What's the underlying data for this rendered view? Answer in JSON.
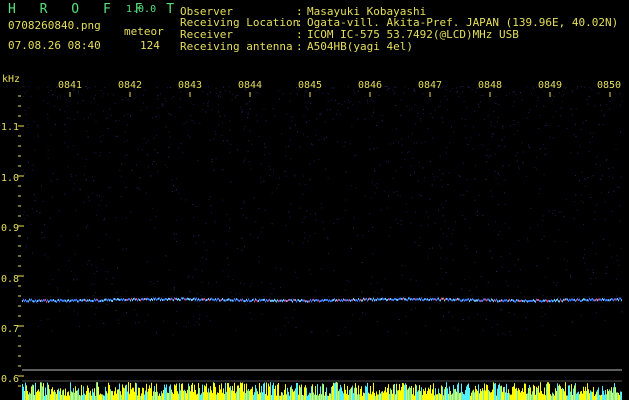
{
  "header": {
    "app_name": "H R O F F T",
    "app_version": "1.0.0",
    "filename": "0708260840.png",
    "datetime": "07.08.26 08:40",
    "meteor_label": "meteor",
    "meteor_count": "124",
    "info": [
      {
        "label": "Observer",
        "value": "Masayuki Kobayashi"
      },
      {
        "label": "Receiving Location",
        "value": "Ogata-vill. Akita-Pref. JAPAN (139.96E, 40.02N)"
      },
      {
        "label": "Receiver",
        "value": "ICOM IC-575 53.7492(@LCD)MHz USB"
      },
      {
        "label": "Receiving antenna",
        "value": "A504HB(yagi 4el)"
      }
    ],
    "separator": ":"
  },
  "spectrogram": {
    "y_unit": "kHz",
    "y_ticks": [
      "1.1",
      "1.0",
      "0.9",
      "0.8",
      "0.7",
      "0.6"
    ],
    "x_ticks": [
      "0841",
      "0842",
      "0843",
      "0844",
      "0845",
      "0846",
      "0847",
      "0848",
      "0849",
      "0850"
    ],
    "signal_line_khz": 0.76,
    "colors": {
      "background": "#000000",
      "axis_text": "#e6df5c",
      "title_text": "#58e07a",
      "signal_blue": "#3a7bff",
      "signal_red": "#ff4060",
      "noise_dots": "#1a1a50",
      "tick_marks": "#f0e050",
      "bottom_bars_yellow": "#ffff00",
      "bottom_bars_cyan": "#4ff0ff",
      "baseline": "#bdbdbd"
    }
  }
}
